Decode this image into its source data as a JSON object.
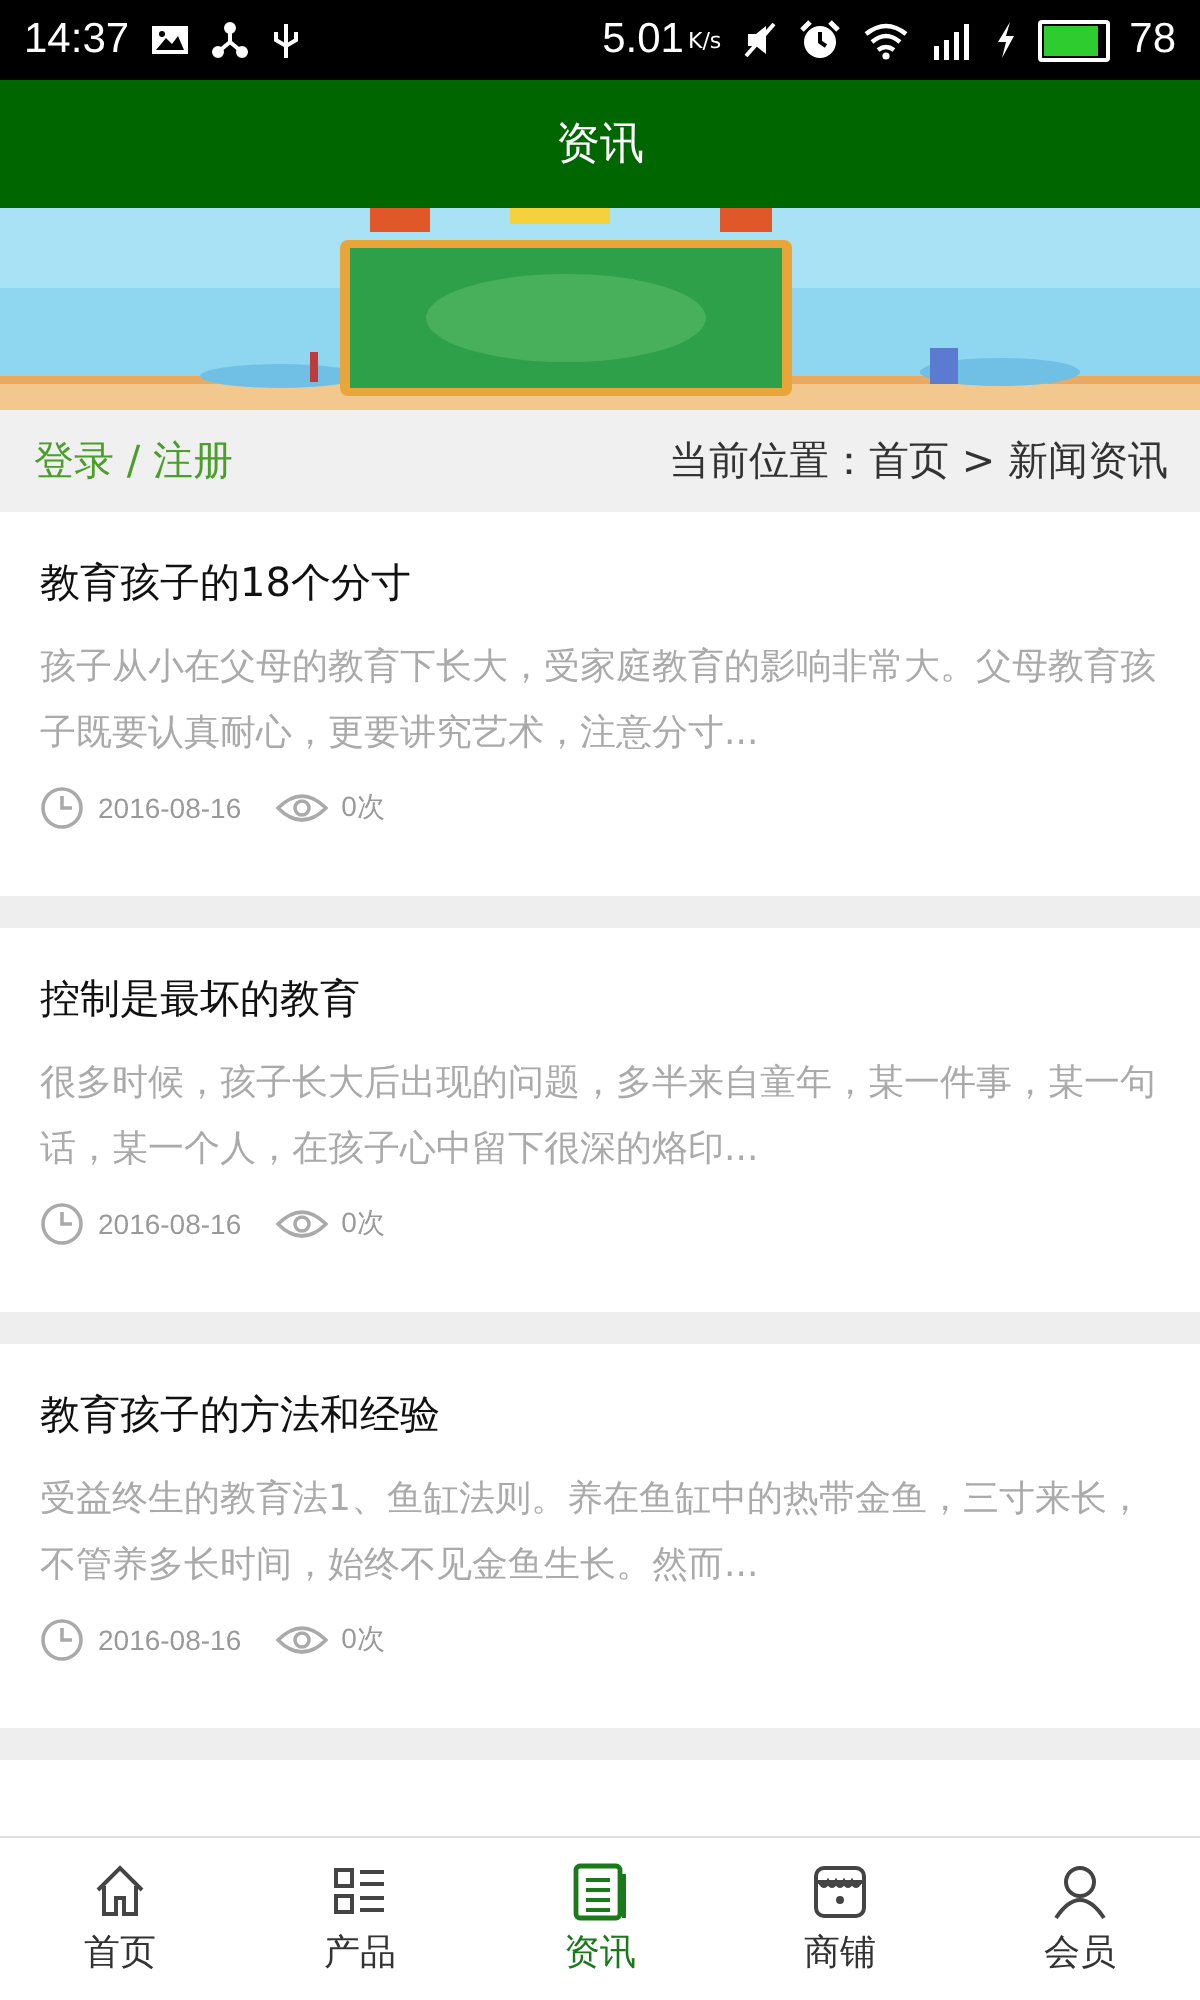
{
  "status_bar": {
    "time": "14:37",
    "speed": "5.01",
    "speed_unit": "K/s",
    "battery": "78"
  },
  "header": {
    "title": "资讯"
  },
  "breadcrumb_bar": {
    "login": "登录 / 注册",
    "location": "当前位置：首页 > 新闻资讯"
  },
  "articles": [
    {
      "title": "教育孩子的18个分寸",
      "summary": "孩子从小在父母的教育下长大，受家庭教育的影响非常大。父母教育孩子既要认真耐心，更要讲究艺术，注意分寸...",
      "date": "2016-08-16",
      "views": "0次"
    },
    {
      "title": "控制是最坏的教育",
      "summary": "很多时候，孩子长大后出现的问题，多半来自童年，某一件事，某一句话，某一个人，在孩子心中留下很深的烙印...",
      "date": "2016-08-16",
      "views": "0次"
    },
    {
      "title": "教育孩子的方法和经验",
      "summary": "受益终生的教育法1、鱼缸法则。养在鱼缸中的热带金鱼，三寸来长，不管养多长时间，始终不见金鱼生长。然而...",
      "date": "2016-08-16",
      "views": "0次"
    }
  ],
  "bottom_nav": [
    {
      "label": "首页",
      "selected": false
    },
    {
      "label": "产品",
      "selected": false
    },
    {
      "label": "资讯",
      "selected": true
    },
    {
      "label": "商铺",
      "selected": false
    },
    {
      "label": "会员",
      "selected": false
    }
  ]
}
